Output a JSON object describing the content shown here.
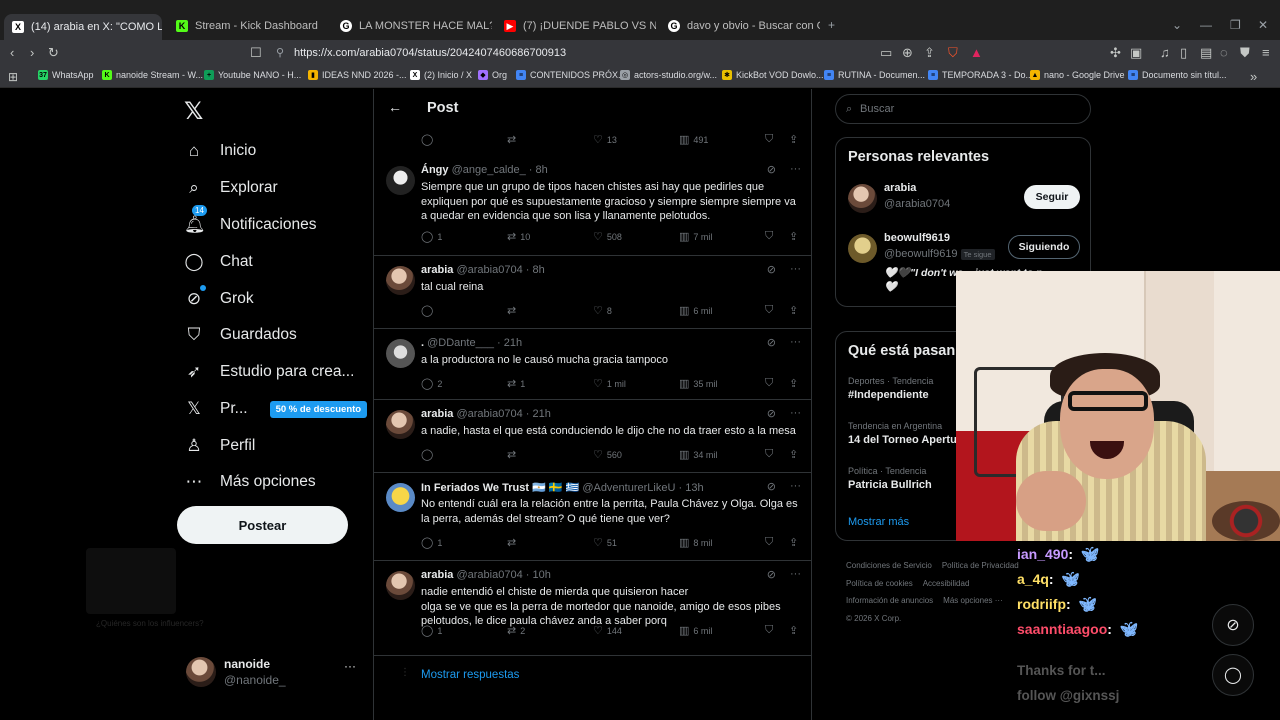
{
  "browser": {
    "tabs": [
      {
        "title": "(14) arabia en X: \"COMO LA BA...",
        "favicon": "x",
        "color": "#ffffff",
        "active": true
      },
      {
        "title": "Stream - Kick Dashboard",
        "favicon": "K",
        "color": "#53fc18"
      },
      {
        "title": "LA MONSTER HACE MAL? - Buscar c...",
        "favicon": "G",
        "color": "#ffffff"
      },
      {
        "title": "(7) ¡DUENDE PABLO VS NANOIDE! S...",
        "favicon": "▶",
        "color": "#ff0000"
      },
      {
        "title": "davo y obvio - Buscar con Google",
        "favicon": "G",
        "color": "#ffffff"
      }
    ],
    "url": "https://x.com/arabia0704/status/2042407460686700913",
    "bookmarks": [
      {
        "label": "WhatsApp",
        "color": "#25d366",
        "glyph": "37"
      },
      {
        "label": "nanoide Stream - W...",
        "color": "#53fc18",
        "glyph": "K"
      },
      {
        "label": "Youtube NANO - H...",
        "color": "#0f9d58",
        "glyph": "+"
      },
      {
        "label": "IDEAS NND 2026 -...",
        "color": "#f4b400",
        "glyph": "▮"
      },
      {
        "label": "(2) Inicio / X",
        "color": "#ffffff",
        "glyph": "X"
      },
      {
        "label": "Org",
        "color": "#a070ff",
        "glyph": "◆"
      },
      {
        "label": "CONTENIDOS PRÓX...",
        "color": "#4285f4",
        "glyph": "≡"
      },
      {
        "label": "actors-studio.org/w...",
        "color": "#9aa0a6",
        "glyph": "◎"
      },
      {
        "label": "KickBot VOD Dowlo...",
        "color": "#e8c000",
        "glyph": "✱"
      },
      {
        "label": "RUTINA - Documen...",
        "color": "#4285f4",
        "glyph": "≡"
      },
      {
        "label": "TEMPORADA 3 - Do...",
        "color": "#4285f4",
        "glyph": "≡"
      },
      {
        "label": "nano - Google Drive",
        "color": "#f4b400",
        "glyph": "▲"
      },
      {
        "label": "Documento sin títul...",
        "color": "#4285f4",
        "glyph": "≡"
      }
    ]
  },
  "nav": {
    "items": [
      {
        "label": "Inicio",
        "icon": "home-icon",
        "glyph": "⌂"
      },
      {
        "label": "Explorar",
        "icon": "search-icon",
        "glyph": "⌕"
      },
      {
        "label": "Notificaciones",
        "icon": "bell-icon",
        "glyph": "🔔︎",
        "badge": "14"
      },
      {
        "label": "Chat",
        "icon": "chat-icon",
        "glyph": "◯"
      },
      {
        "label": "Grok",
        "icon": "grok-icon",
        "glyph": "⊘"
      },
      {
        "label": "Guardados",
        "icon": "bookmark-icon",
        "glyph": "⛉"
      },
      {
        "label": "Estudio para crea...",
        "icon": "rocket-icon",
        "glyph": "➶"
      },
      {
        "label": "Pr...",
        "icon": "x-premium-icon",
        "glyph": "𝕏",
        "promo": "50 % de descuento"
      },
      {
        "label": "Perfil",
        "icon": "person-icon",
        "glyph": "♙"
      },
      {
        "label": "Más opciones",
        "icon": "more-circle-icon",
        "glyph": "⋯"
      }
    ],
    "post_button": "Postear",
    "profile": {
      "name": "nanoide",
      "handle": "@nanoide_"
    },
    "ghost_text": "¿Quiénes son los influencers?"
  },
  "timeline": {
    "title": "Post",
    "top_stats": {
      "likes": "13",
      "views": "491"
    },
    "tweets": [
      {
        "name": "Ángy",
        "handle": "@ange_calde_",
        "time": "8h",
        "text": "Siempre que un grupo de tipos hacen chistes asi hay que pedirles que expliquen por qué es supuestamente gracioso y siempre siempre siempre va a quedar en evidencia que son lisa y llanamente pelotudos.",
        "replies": "1",
        "retweets": "10",
        "likes": "508",
        "views": "7 mil"
      },
      {
        "name": "arabia",
        "handle": "@arabia0704",
        "time": "8h",
        "text": "tal cual reina",
        "replies": "",
        "retweets": "",
        "likes": "8",
        "views": "6 mil"
      },
      {
        "name": ".",
        "handle": "@DDante___",
        "time": "21h",
        "text": "a la productora no le causó mucha gracia tampoco",
        "replies": "2",
        "retweets": "1",
        "likes": "1 mil",
        "views": "35 mil"
      },
      {
        "name": "arabia",
        "handle": "@arabia0704",
        "time": "21h",
        "text": "a nadie, hasta el que está conduciendo le dijo che no da traer esto a la mesa",
        "replies": "",
        "retweets": "",
        "likes": "560",
        "views": "34 mil"
      },
      {
        "name": "In Feriados We Trust 🇦🇷 🇸🇪 🇬🇷",
        "handle": "@AdventurerLikeU",
        "time": "13h",
        "text": "No entendí cuál era la relación entre la perrita, Paula Chávez y Olga. Olga es la perra, además del stream? O qué tiene que ver?",
        "replies": "1",
        "retweets": "",
        "likes": "51",
        "views": "8 mil"
      },
      {
        "name": "arabia",
        "handle": "@arabia0704",
        "time": "10h",
        "text": "nadie entendió el chiste de mierda que quisieron hacer\nolga se ve que es la perra de mortedor que nanoide, amigo de esos pibes pelotudos, le dice paula chávez anda a saber porq",
        "replies": "1",
        "retweets": "2",
        "likes": "144",
        "views": "6 mil"
      }
    ],
    "show_replies": "Mostrar respuestas"
  },
  "sidebar": {
    "search_placeholder": "Buscar",
    "relevant_title": "Personas relevantes",
    "people": [
      {
        "name": "arabia",
        "handle": "@arabia0704",
        "button": "Seguir"
      },
      {
        "name": "beowulf9619",
        "handle": "@beowulf9619",
        "follows_you": "Te sigue",
        "button": "Siguiendo",
        "bio": "🤍🖤\"I don't wa... just want to n... 🤍"
      }
    ],
    "trends_title": "Qué está pasan...",
    "trends": [
      {
        "context": "Deportes · Tendencia",
        "topic": "#Independiente"
      },
      {
        "context": "Tendencia en Argentina",
        "topic": "14 del Torneo Apertu..."
      },
      {
        "context": "Política · Tendencia",
        "topic": "Patricia Bullrich"
      }
    ],
    "show_more": "Mostrar más",
    "footer": [
      "Condiciones de Servicio",
      "Política de Privacidad",
      "Política de cookies",
      "Accesibilidad",
      "Información de anuncios",
      "Más opciones ···",
      "© 2026 X Corp."
    ]
  },
  "stream_chat": [
    {
      "user": "ian_490",
      "color": "#c79bff"
    },
    {
      "user": "a_4q",
      "color": "#ffe066"
    },
    {
      "user": "rodriifp",
      "color": "#ffe066"
    },
    {
      "user": "saanntiaagoo",
      "color": "#ff4d6a"
    }
  ],
  "faded_chat": [
    "Thanks for t...",
    "follow @gixnssj"
  ]
}
